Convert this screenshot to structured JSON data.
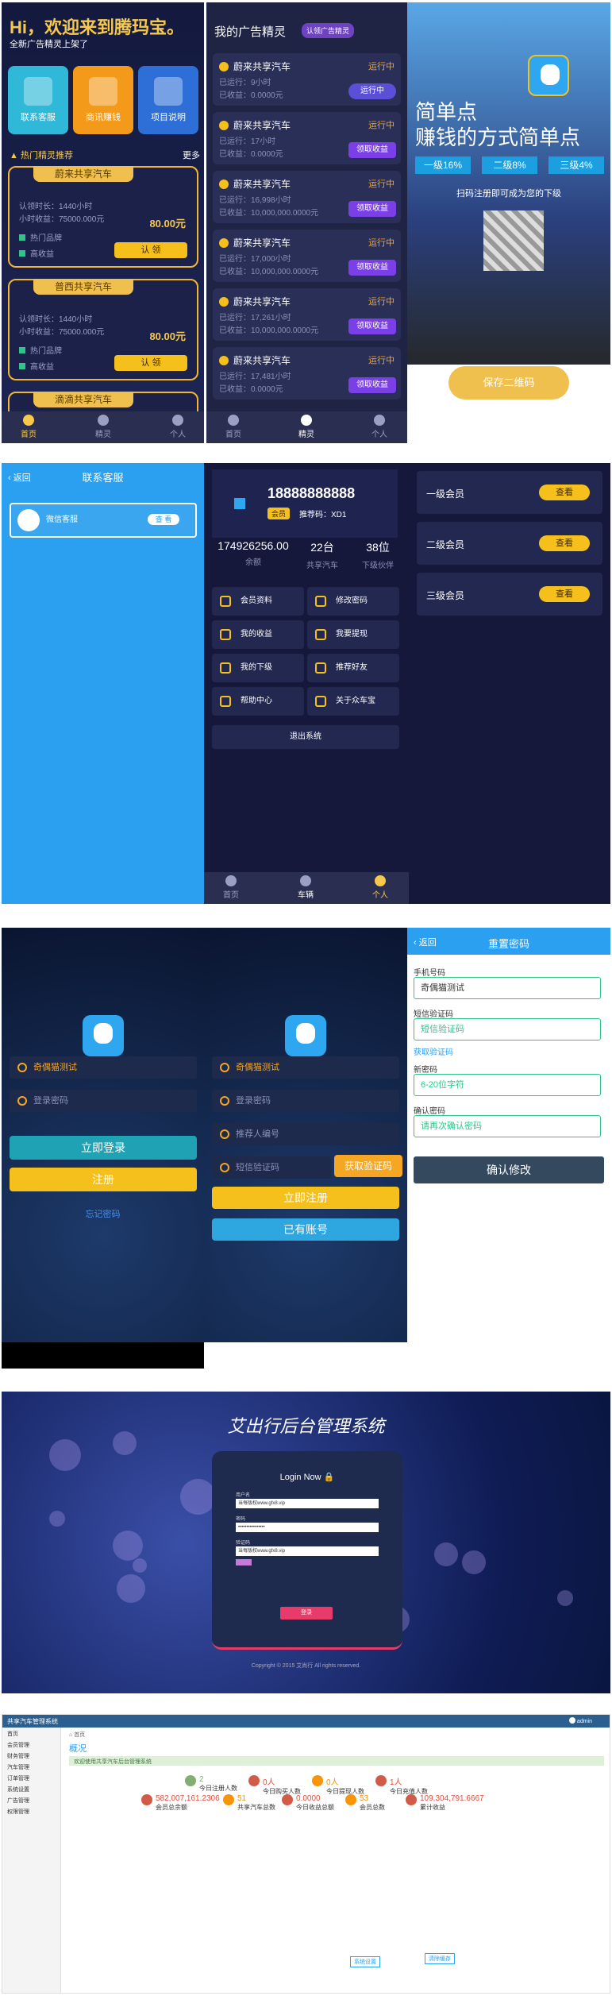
{
  "s1": {
    "greeting": "Hi，欢迎来到腾玛宝。",
    "subtitle": "全新广告精灵上架了",
    "tiles": [
      "联系客服",
      "商讯赚钱",
      "项目说明"
    ],
    "hot_label": "热门精灵推荐",
    "more": "更多",
    "cards": [
      {
        "name": "蔚来共享汽车",
        "period": "认领时长：1440小时",
        "hourly": "小时收益：75000.000元",
        "price": "80.00元",
        "chk1": "热门品牌",
        "chk2": "高收益",
        "btn": "认 领"
      },
      {
        "name": "普西共享汽车",
        "period": "认领时长：1440小时",
        "hourly": "小时收益：75000.000元",
        "price": "80.00元",
        "chk1": "热门品牌",
        "chk2": "高收益",
        "btn": "认 领"
      },
      {
        "name": "滴滴共享汽车"
      }
    ],
    "tabs": [
      "首页",
      "精灵",
      "个人"
    ],
    "ad_title": "我的广告精灵",
    "ad_badge": "认领广告精灵",
    "ads": [
      {
        "name": "蔚来共享汽车",
        "status": "运行中",
        "run": "已运行：9小时",
        "earn": "已收益：0.0000元",
        "btn": "运行中"
      },
      {
        "name": "蔚来共享汽车",
        "status": "运行中",
        "run": "已运行：17小时",
        "earn": "已收益：0.0000元",
        "btn": "领取收益"
      },
      {
        "name": "蔚来共享汽车",
        "status": "运行中",
        "run": "已运行：16,998小时",
        "earn": "已收益：10,000,000.0000元",
        "btn": "领取收益"
      },
      {
        "name": "蔚来共享汽车",
        "status": "运行中",
        "run": "已运行：17,000小时",
        "earn": "已收益：10,000,000.0000元",
        "btn": "领取收益"
      },
      {
        "name": "蔚来共享汽车",
        "status": "运行中",
        "run": "已运行：17,261小时",
        "earn": "已收益：10,000,000.0000元",
        "btn": "领取收益"
      },
      {
        "name": "蔚来共享汽车",
        "status": "运行中",
        "run": "已运行：17,481小时",
        "earn": "已收益：0.0000元",
        "btn": "领取收益"
      }
    ],
    "promo_line1": "简单点",
    "promo_line2": "赚钱的方式简单点",
    "levels": [
      "一级16%",
      "二级8%",
      "三级4%"
    ],
    "scan_tip": "扫码注册即可成为您的下级",
    "save_btn": "保存二维码"
  },
  "s2": {
    "back": "返回",
    "title": "联系客服",
    "service": "微信客服",
    "view": "查 看",
    "phone": "18888888888",
    "level_badge": "会员",
    "invite": "推荐码：XD1",
    "stats": [
      {
        "v": "174926256.00",
        "l": "余额"
      },
      {
        "v": "22台",
        "l": "共享汽车"
      },
      {
        "v": "38位",
        "l": "下级伙伴"
      }
    ],
    "menu": [
      "会员资料",
      "修改密码",
      "我的收益",
      "我要提现",
      "我的下级",
      "推荐好友",
      "帮助中心",
      "关于众车宝"
    ],
    "logout": "退出系统",
    "tabs": [
      "首页",
      "车辆",
      "个人"
    ],
    "vips": [
      "一级会员",
      "二级会员",
      "三级会员"
    ],
    "vip_btn": "查看"
  },
  "s3": {
    "login_user": "奇偶猫测试",
    "login_pwd": "登录密码",
    "login_btn": "立即登录",
    "reg_btn": "注册",
    "forget": "忘记密码",
    "reg_user": "奇偶猫测试",
    "reg_pwd": "登录密码",
    "reg_ref": "推荐人编号",
    "reg_code": "短信验证码",
    "get_code": "获取验证码",
    "reg_submit": "立即注册",
    "have_acct": "已有账号",
    "reset_back": "返回",
    "reset_title": "重置密码",
    "phone_label": "手机号码",
    "phone_val": "奇偶猫测试",
    "sms_label": "短信验证码",
    "sms_ph": "短信验证码",
    "sms_link": "获取验证码",
    "newpwd_label": "新密码",
    "newpwd_ph": "6-20位字符",
    "confirm_label": "确认密码",
    "confirm_ph": "请再次确认密码",
    "confirm_btn": "确认修改"
  },
  "s4": {
    "title": "艾出行后台管理系统",
    "login_now": "Login Now",
    "user_label": "用户名",
    "user_val": "当每版权www.gfx8.vip",
    "pwd_label": "密码",
    "pwd_val": "••••••••••••••••",
    "code_label": "验证码",
    "code_val": "当每版权www.gfx8.vip",
    "submit": "登录",
    "copyright": "Copyright © 2015 艾尚行 All rights reserved."
  },
  "s5": {
    "app_title": "共享汽车管理系统",
    "user": "admin",
    "crumb": "首页",
    "page_title": "概况",
    "notice": "欢迎使用共享汽车后台管理系统",
    "side": [
      "首页",
      "会员管理",
      "财务管理",
      "汽车管理",
      "订单管理",
      "系统设置",
      "广告管理",
      "权限管理"
    ],
    "stats_row1": [
      {
        "v": "2",
        "l": "今日注册人数"
      },
      {
        "v": "0人",
        "l": "今日购买人数"
      },
      {
        "v": "0人",
        "l": "今日提现人数"
      },
      {
        "v": "1人",
        "l": "今日充值人数"
      }
    ],
    "stats_row2": [
      {
        "v": "582,007,161.2306",
        "l": "会员总余额"
      },
      {
        "v": "51",
        "l": "共享汽车总数"
      },
      {
        "v": "0.0000",
        "l": "今日收益总额"
      },
      {
        "v": "53",
        "l": "会员总数"
      },
      {
        "v": "109,304,791.6667",
        "l": "累计收益"
      }
    ],
    "btn1": "系统设置",
    "btn2": "清除缓存"
  }
}
